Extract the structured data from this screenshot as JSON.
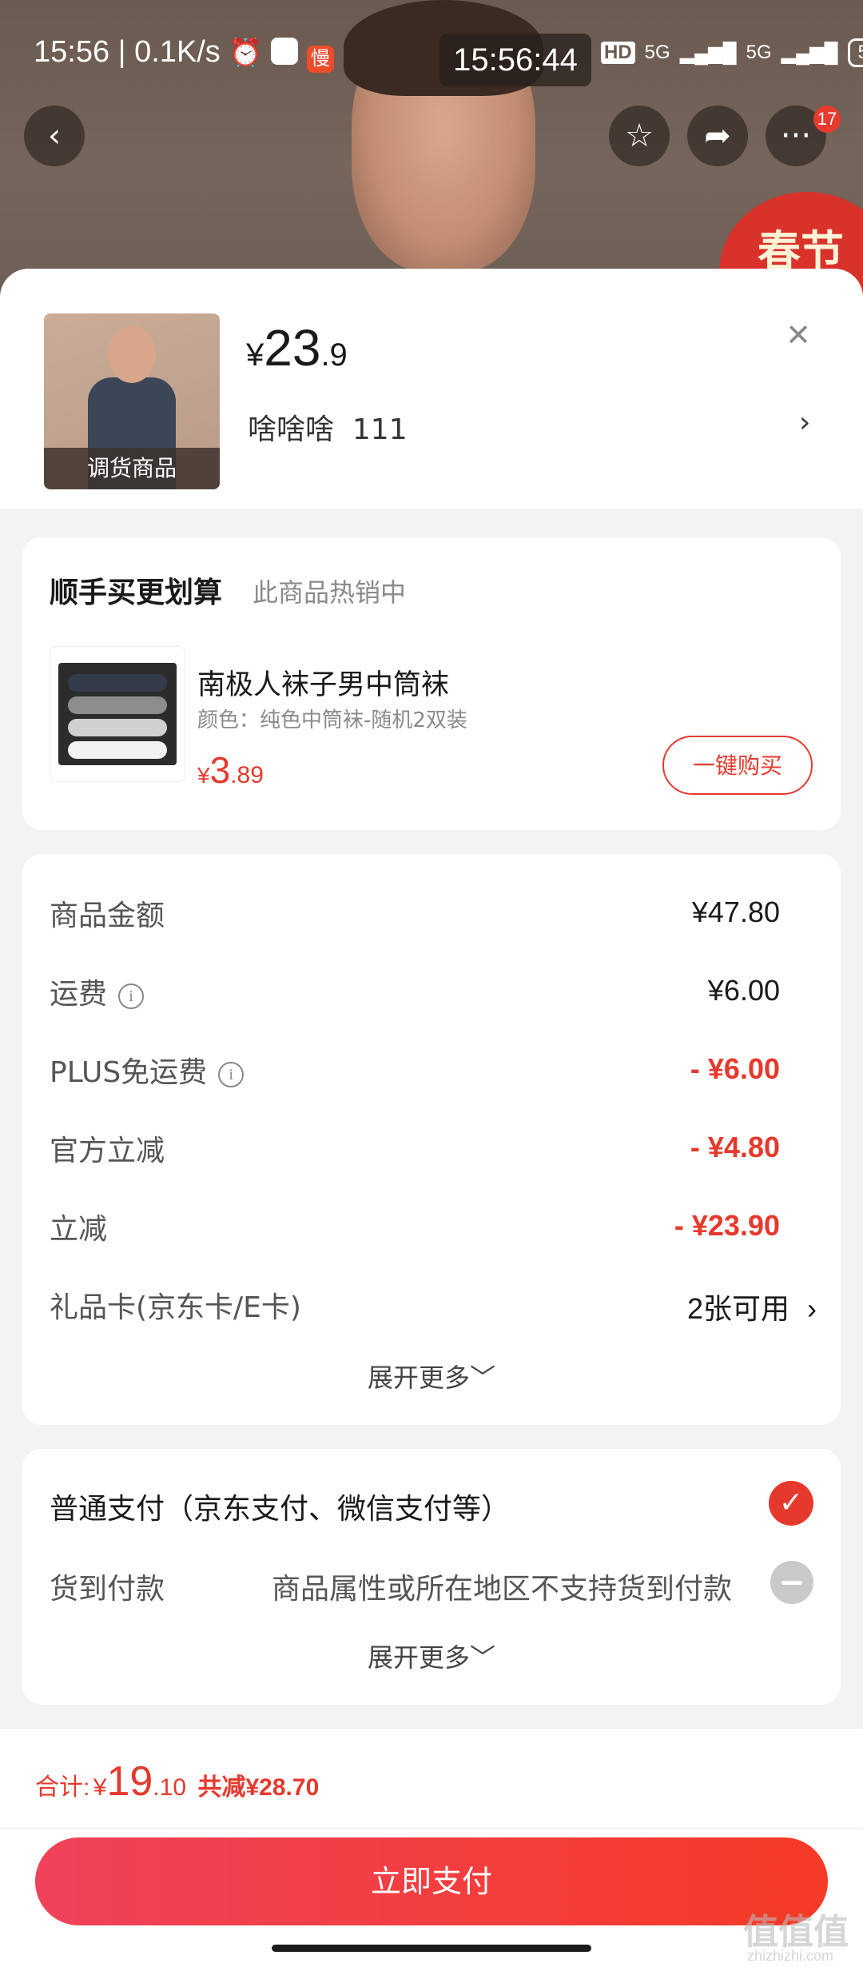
{
  "status_bar": {
    "time_network": "15:56 | 0.1K/s",
    "overlay_clock": "15:56:44",
    "hd": "HD",
    "net1": "5G",
    "net2": "5G",
    "battery": "52",
    "slow_badge": "慢"
  },
  "header": {
    "notification_count": "17",
    "promo_text": "春节"
  },
  "product": {
    "thumb_tag": "调货商品",
    "price_symbol": "¥",
    "price_int": "23",
    "price_dec": ".9",
    "sku": "啥啥啥  111",
    "sku_chevron": "›"
  },
  "upsell": {
    "title": "顺手买更划算",
    "subtitle": "此商品热销中",
    "item_name": "南极人袜子男中筒袜",
    "item_spec": "颜色：纯色中筒袜-随机2双装",
    "price_symbol": "¥",
    "price_int": "3",
    "price_dec": ".89",
    "buy_label": "一键购买"
  },
  "costs": {
    "rows": [
      {
        "label": "商品金额",
        "value": "¥47.80"
      },
      {
        "label": "运费",
        "value": "¥6.00"
      },
      {
        "label": "PLUS免运费",
        "value": "- ¥6.00"
      },
      {
        "label": "官方立减",
        "value": "- ¥4.80"
      },
      {
        "label": "立减",
        "value": "- ¥23.90"
      },
      {
        "label": "礼品卡(京东卡/E卡)",
        "value": "2张可用"
      }
    ],
    "info_icon": "i",
    "gift_chevron": "›",
    "expand_label": "展开更多﹀"
  },
  "payment": {
    "normal_label": "普通支付（京东支付、微信支付等）",
    "cod_label": "货到付款",
    "cod_note": "商品属性或所在地区不支持货到付款",
    "check_mark": "✓",
    "expand_label": "展开更多﹀"
  },
  "footer": {
    "total_label": "合计:",
    "total_symbol": "¥",
    "total_int": "19",
    "total_dec": ".10",
    "saved": "共减¥28.70",
    "pay_button": "立即支付"
  },
  "watermark": {
    "main": "值值值",
    "sub": "zhizhizhi.com"
  },
  "colors": {
    "accent_red": "#e6392d",
    "pay_gradient_start": "#f0425a",
    "pay_gradient_end": "#f53a26"
  }
}
